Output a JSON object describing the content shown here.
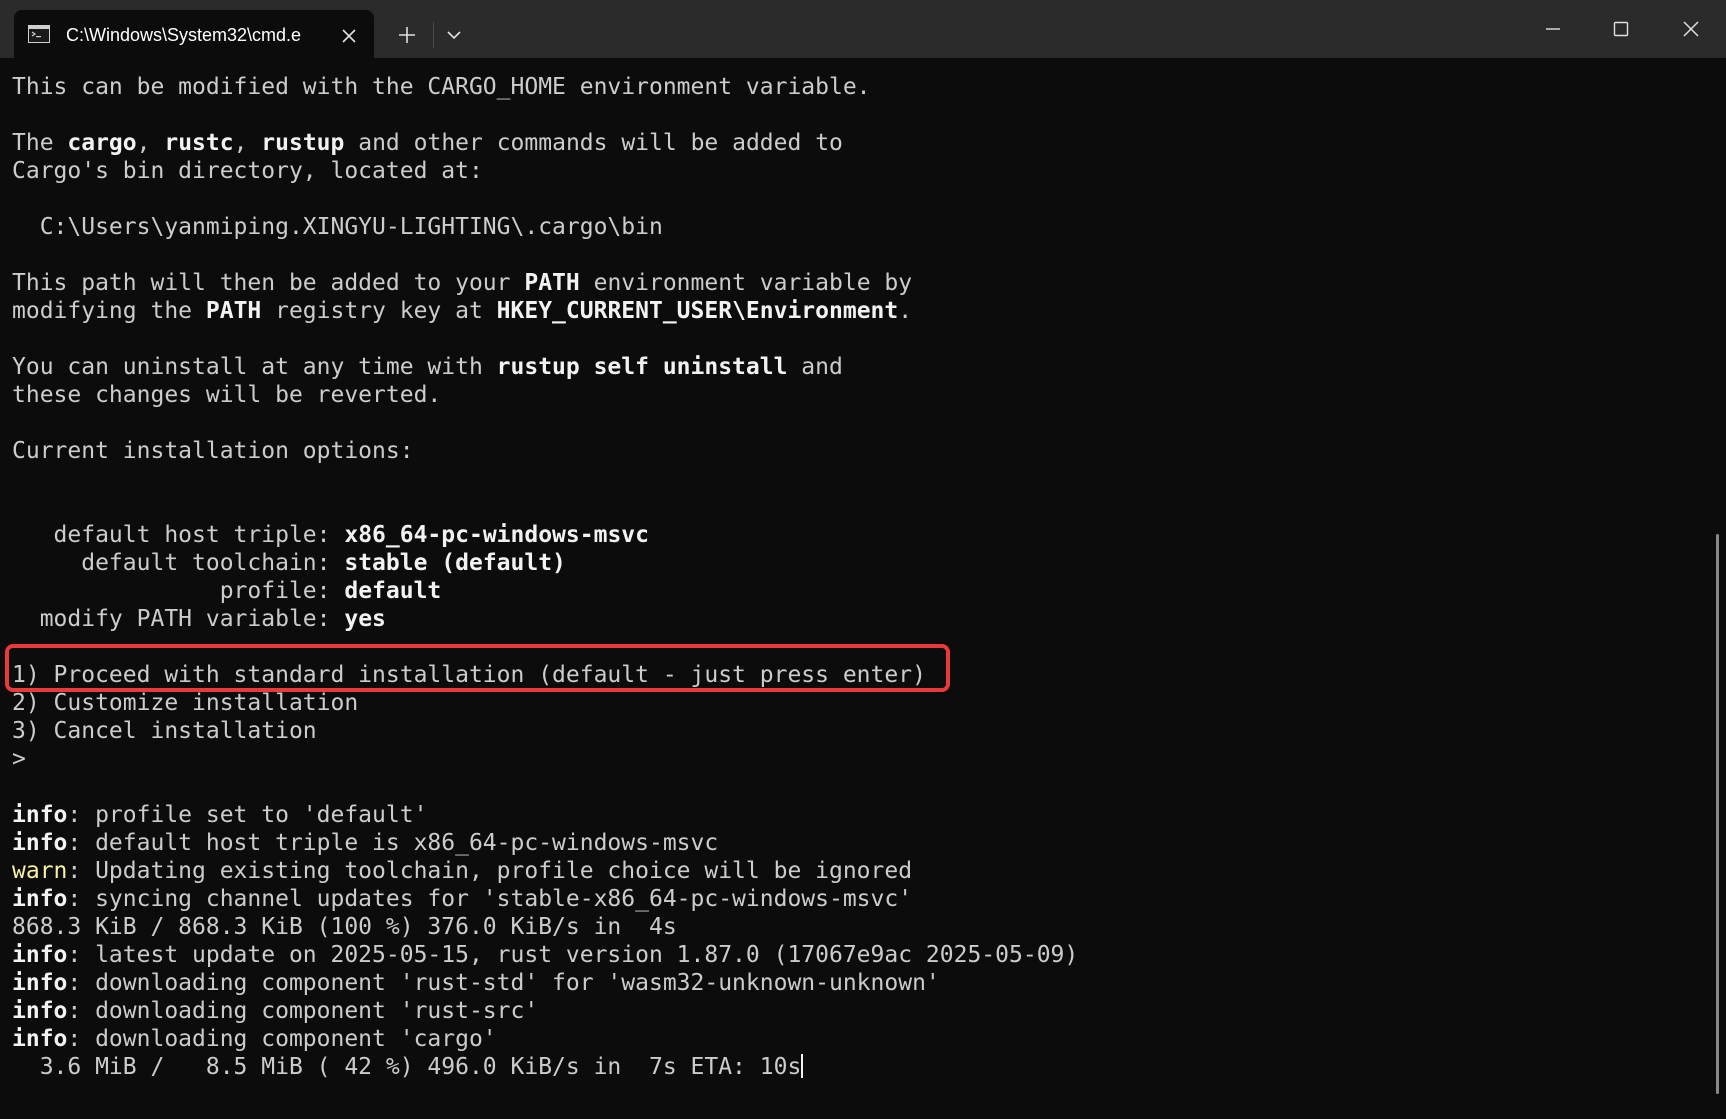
{
  "window": {
    "tab_title": "C:\\Windows\\System32\\cmd.e",
    "tab_icon": "cmd-prompt-icon",
    "controls": {
      "tab_close": "close-icon",
      "new_tab": "plus-icon",
      "dropdown": "chevron-down-icon",
      "minimize": "minimize-icon",
      "maximize": "maximize-icon",
      "close": "close-icon"
    }
  },
  "colors": {
    "terminal_bg": "#0c0c0c",
    "titlebar_bg": "#2b2b2b",
    "text": "#cccccc",
    "bold_text": "#f2f2f2",
    "warn": "#f9f1a5",
    "highlight_box": "#e83a3a"
  },
  "terminal": {
    "lines": [
      [
        {
          "t": "This can be modified with the CARGO_HOME environment variable."
        }
      ],
      [],
      [
        {
          "t": "The "
        },
        {
          "t": "cargo",
          "s": "b"
        },
        {
          "t": ", "
        },
        {
          "t": "rustc",
          "s": "b"
        },
        {
          "t": ", "
        },
        {
          "t": "rustup",
          "s": "b"
        },
        {
          "t": " and other commands will be added to"
        }
      ],
      [
        {
          "t": "Cargo's bin directory, located at:"
        }
      ],
      [],
      [
        {
          "t": "  C:\\Users\\yanmiping.XINGYU-LIGHTING\\.cargo\\bin"
        }
      ],
      [],
      [
        {
          "t": "This path will then be added to your "
        },
        {
          "t": "PATH",
          "s": "b"
        },
        {
          "t": " environment variable by"
        }
      ],
      [
        {
          "t": "modifying the "
        },
        {
          "t": "PATH",
          "s": "b"
        },
        {
          "t": " registry key at "
        },
        {
          "t": "HKEY_CURRENT_USER\\Environment",
          "s": "b"
        },
        {
          "t": "."
        }
      ],
      [],
      [
        {
          "t": "You can uninstall at any time with "
        },
        {
          "t": "rustup self uninstall",
          "s": "b"
        },
        {
          "t": " and"
        }
      ],
      [
        {
          "t": "these changes will be reverted."
        }
      ],
      [],
      [
        {
          "t": "Current installation options:"
        }
      ],
      [],
      [],
      [
        {
          "t": "   default host triple: "
        },
        {
          "t": "x86_64-pc-windows-msvc",
          "s": "b"
        }
      ],
      [
        {
          "t": "     default toolchain: "
        },
        {
          "t": "stable (default)",
          "s": "b"
        }
      ],
      [
        {
          "t": "               profile: "
        },
        {
          "t": "default",
          "s": "b"
        }
      ],
      [
        {
          "t": "  modify PATH variable: "
        },
        {
          "t": "yes",
          "s": "b"
        }
      ],
      [],
      [
        {
          "t": "1) Proceed with standard installation (default - just press enter)"
        }
      ],
      [
        {
          "t": "2) Customize installation"
        }
      ],
      [
        {
          "t": "3) Cancel installation"
        }
      ],
      [
        {
          "t": ">"
        }
      ],
      [],
      [
        {
          "t": "info",
          "s": "b"
        },
        {
          "t": ": profile set to 'default'"
        }
      ],
      [
        {
          "t": "info",
          "s": "b"
        },
        {
          "t": ": default host triple is x86_64-pc-windows-msvc"
        }
      ],
      [
        {
          "t": "warn",
          "s": "w"
        },
        {
          "t": ": Updating existing toolchain, profile choice will be ignored"
        }
      ],
      [
        {
          "t": "info",
          "s": "b"
        },
        {
          "t": ": syncing channel updates for 'stable-x86_64-pc-windows-msvc'"
        }
      ],
      [
        {
          "t": "868.3 KiB / 868.3 KiB (100 %) 376.0 KiB/s in  4s"
        }
      ],
      [
        {
          "t": "info",
          "s": "b"
        },
        {
          "t": ": latest update on 2025-05-15, rust version 1.87.0 (17067e9ac 2025-05-09)"
        }
      ],
      [
        {
          "t": "info",
          "s": "b"
        },
        {
          "t": ": downloading component 'rust-std' for 'wasm32-unknown-unknown'"
        }
      ],
      [
        {
          "t": "info",
          "s": "b"
        },
        {
          "t": ": downloading component 'rust-src'"
        }
      ],
      [
        {
          "t": "info",
          "s": "b"
        },
        {
          "t": ": downloading component 'cargo'"
        }
      ],
      [
        {
          "t": "  3.6 MiB /   8.5 MiB ( 42 %) 496.0 KiB/s in  7s ETA: 10s"
        },
        {
          "cursor": true
        }
      ]
    ]
  }
}
